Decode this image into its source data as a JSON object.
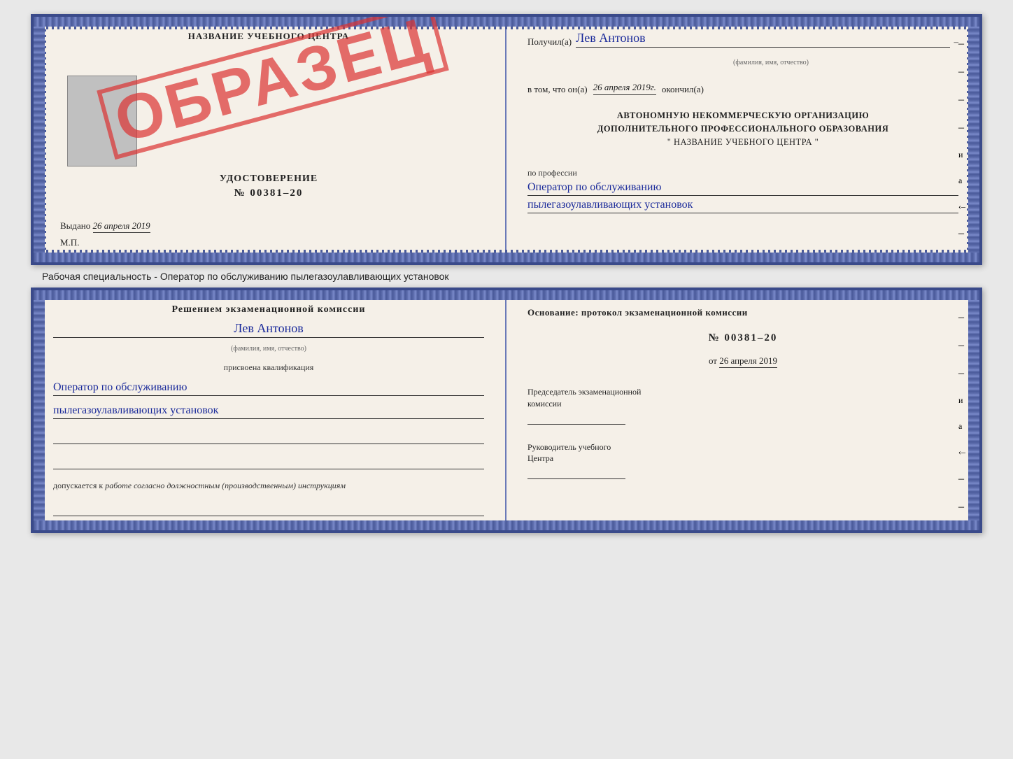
{
  "top_cert": {
    "left": {
      "title": "НАЗВАНИЕ УЧЕБНОГО ЦЕНТРА",
      "obrazec": "ОБРАЗЕЦ",
      "udostoverenie_label": "УДОСТОВЕРЕНИЕ",
      "number": "№ 00381–20",
      "vydano": "Выдано",
      "vydano_date": "26 апреля 2019",
      "mp": "М.П."
    },
    "right": {
      "poluchil_label": "Получил(а)",
      "name": "Лев Антонов",
      "dash": "–",
      "fio_label": "(фамилия, имя, отчество)",
      "vtom_label": "в том, что он(а)",
      "date": "26 апреля 2019г.",
      "okончил_label": "окончил(а)",
      "org_line1": "АВТОНОМНУЮ НЕКОММЕРЧЕСКУЮ ОРГАНИЗАЦИЮ",
      "org_line2": "ДОПОЛНИТЕЛЬНОГО ПРОФЕССИОНАЛЬНОГО ОБРАЗОВАНИЯ",
      "org_name_q1": "\"",
      "org_name": "НАЗВАНИЕ УЧЕБНОГО ЦЕНТРА",
      "org_name_q2": "\"",
      "po_professii": "по профессии",
      "profession1": "Оператор по обслуживанию",
      "profession2": "пылегазоулавливающих установок",
      "side_dashes": [
        "–",
        "–",
        "–",
        "–",
        "и",
        "а",
        "‹–",
        "–",
        "–",
        "–",
        "–"
      ]
    }
  },
  "between": {
    "text": "Рабочая специальность - Оператор по обслуживанию пылегазоулавливающих установок"
  },
  "bottom_cert": {
    "left": {
      "resheniem_title": "Решением экзаменационной комиссии",
      "name": "Лев Антонов",
      "fio_label": "(фамилия, имя, отчество)",
      "prisvoena_label": "присвоена квалификация",
      "profession1": "Оператор по обслуживанию",
      "profession2": "пылегазоулавливающих установок",
      "dopuskaetsya": "допускается к",
      "dopuskaetsya_value": "работе согласно должностным (производственным) инструкциям"
    },
    "right": {
      "osnov_title": "Основание: протокол экзаменационной комиссии",
      "protocol_number": "№ 00381–20",
      "ot_label": "от",
      "ot_date": "26 апреля 2019",
      "predsedatel_line1": "Председатель экзаменационной",
      "predsedatel_line2": "комиссии",
      "rukovoditel_line1": "Руководитель учебного",
      "rukovoditel_line2": "Центра",
      "side_dashes": [
        "–",
        "–",
        "–",
        "и",
        "а",
        "‹–",
        "–",
        "–",
        "–",
        "–"
      ]
    }
  }
}
